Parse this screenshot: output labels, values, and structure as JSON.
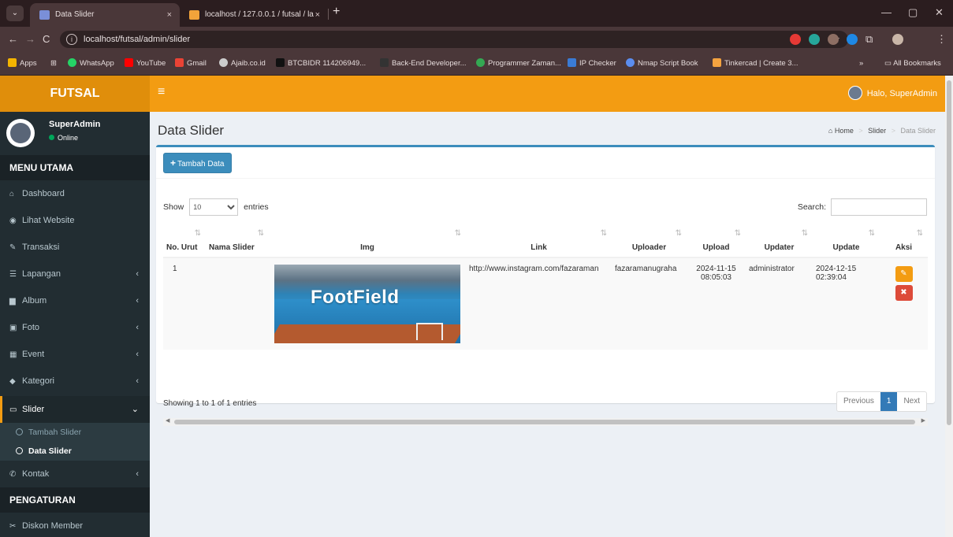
{
  "browser": {
    "menu_icon": "chevron-down-icon",
    "tabs": [
      {
        "title": "Data Slider",
        "close": "×"
      },
      {
        "title": "localhost / 127.0.0.1 / futsal / la",
        "close": "×"
      }
    ],
    "new_tab": "+",
    "url": "localhost/futsal/admin/slider",
    "nav": {
      "back": "←",
      "forward": "→",
      "reload": "C"
    },
    "bookmarks": [
      {
        "label": "Apps",
        "color": "#f4b400"
      },
      {
        "label": "WhatsApp",
        "color": "#25d366"
      },
      {
        "label": "YouTube",
        "color": "#ff0000"
      },
      {
        "label": "Gmail",
        "color": "#ea4335"
      },
      {
        "label": "Ajaib.co.id",
        "color": "#cccccc"
      },
      {
        "label": "BTCBIDR 114206949...",
        "color": "#111111"
      },
      {
        "label": "Back-End Developer...",
        "color": "#333333"
      },
      {
        "label": "Programmer Zaman...",
        "color": "#34a853"
      },
      {
        "label": "IP Checker",
        "color": "#3a7bd5"
      },
      {
        "label": "Nmap Script Book",
        "color": "#5b8def"
      },
      {
        "label": "Tinkercad | Create 3...",
        "color": "#f4a340"
      }
    ],
    "bookmarks_more": "»",
    "all_bookmarks": "All Bookmarks"
  },
  "app": {
    "brand": "FUTSAL",
    "menu_toggle": "≡",
    "greeting": "Halo, SuperAdmin",
    "user": {
      "name": "SuperAdmin",
      "status": "Online"
    },
    "sidebar": {
      "main_header": "MENU UTAMA",
      "items": [
        {
          "label": "Dashboard",
          "icon": "home-icon",
          "glyph": "⌂",
          "chevron": ""
        },
        {
          "label": "Lihat Website",
          "icon": "globe-icon",
          "glyph": "◉",
          "chevron": ""
        },
        {
          "label": "Transaksi",
          "icon": "pencil-icon",
          "glyph": "✎",
          "chevron": ""
        },
        {
          "label": "Lapangan",
          "icon": "list-icon",
          "glyph": "☰",
          "chevron": "‹"
        },
        {
          "label": "Album",
          "icon": "folder-icon",
          "glyph": "▆",
          "chevron": "‹"
        },
        {
          "label": "Foto",
          "icon": "picture-icon",
          "glyph": "▣",
          "chevron": "‹"
        },
        {
          "label": "Event",
          "icon": "calendar-icon",
          "glyph": "▦",
          "chevron": "‹"
        },
        {
          "label": "Kategori",
          "icon": "tag-icon",
          "glyph": "◆",
          "chevron": "‹"
        },
        {
          "label": "Slider",
          "icon": "slides-icon",
          "glyph": "▭",
          "chevron": "⌄"
        }
      ],
      "sub_items": [
        {
          "label": "Tambah Slider",
          "active": false
        },
        {
          "label": "Data Slider",
          "active": true
        }
      ],
      "after_items": [
        {
          "label": "Kontak",
          "icon": "phone-icon",
          "glyph": "✆",
          "chevron": "‹"
        }
      ],
      "settings_header": "PENGATURAN",
      "settings_items": [
        {
          "label": "Diskon Member",
          "icon": "scissors-icon",
          "glyph": "✂"
        }
      ]
    },
    "page": {
      "title": "Data Slider",
      "breadcrumb": [
        "Home",
        "Slider",
        "Data Slider"
      ],
      "breadcrumb_sep": ">",
      "add_button": "Tambah Data",
      "length": {
        "show": "Show",
        "value": "10",
        "entries": "entries"
      },
      "search_label": "Search:",
      "columns": [
        "No. Urut",
        "Nama Slider",
        "Img",
        "Link",
        "Uploader",
        "Upload",
        "Updater",
        "Update",
        "Aksi"
      ],
      "rows": [
        {
          "no": "1",
          "nama": "",
          "img_text": "FootField",
          "link": "http://www.instagram.com/fazaraman",
          "uploader": "fazaramanugraha",
          "upload": "2024-11-15 08:05:03",
          "updater": "administrator",
          "update": "2024-12-15 02:39:04"
        }
      ],
      "info": "Showing 1 to 1 of 1 entries",
      "pagination": {
        "previous": "Previous",
        "current": "1",
        "next": "Next"
      }
    }
  },
  "colors": {
    "brand_orange": "#f39c12",
    "brand_orange_dark": "#e08e0b",
    "sidebar_bg": "#222d32",
    "primary_blue": "#3c8dbc",
    "danger_red": "#dd4b39"
  }
}
